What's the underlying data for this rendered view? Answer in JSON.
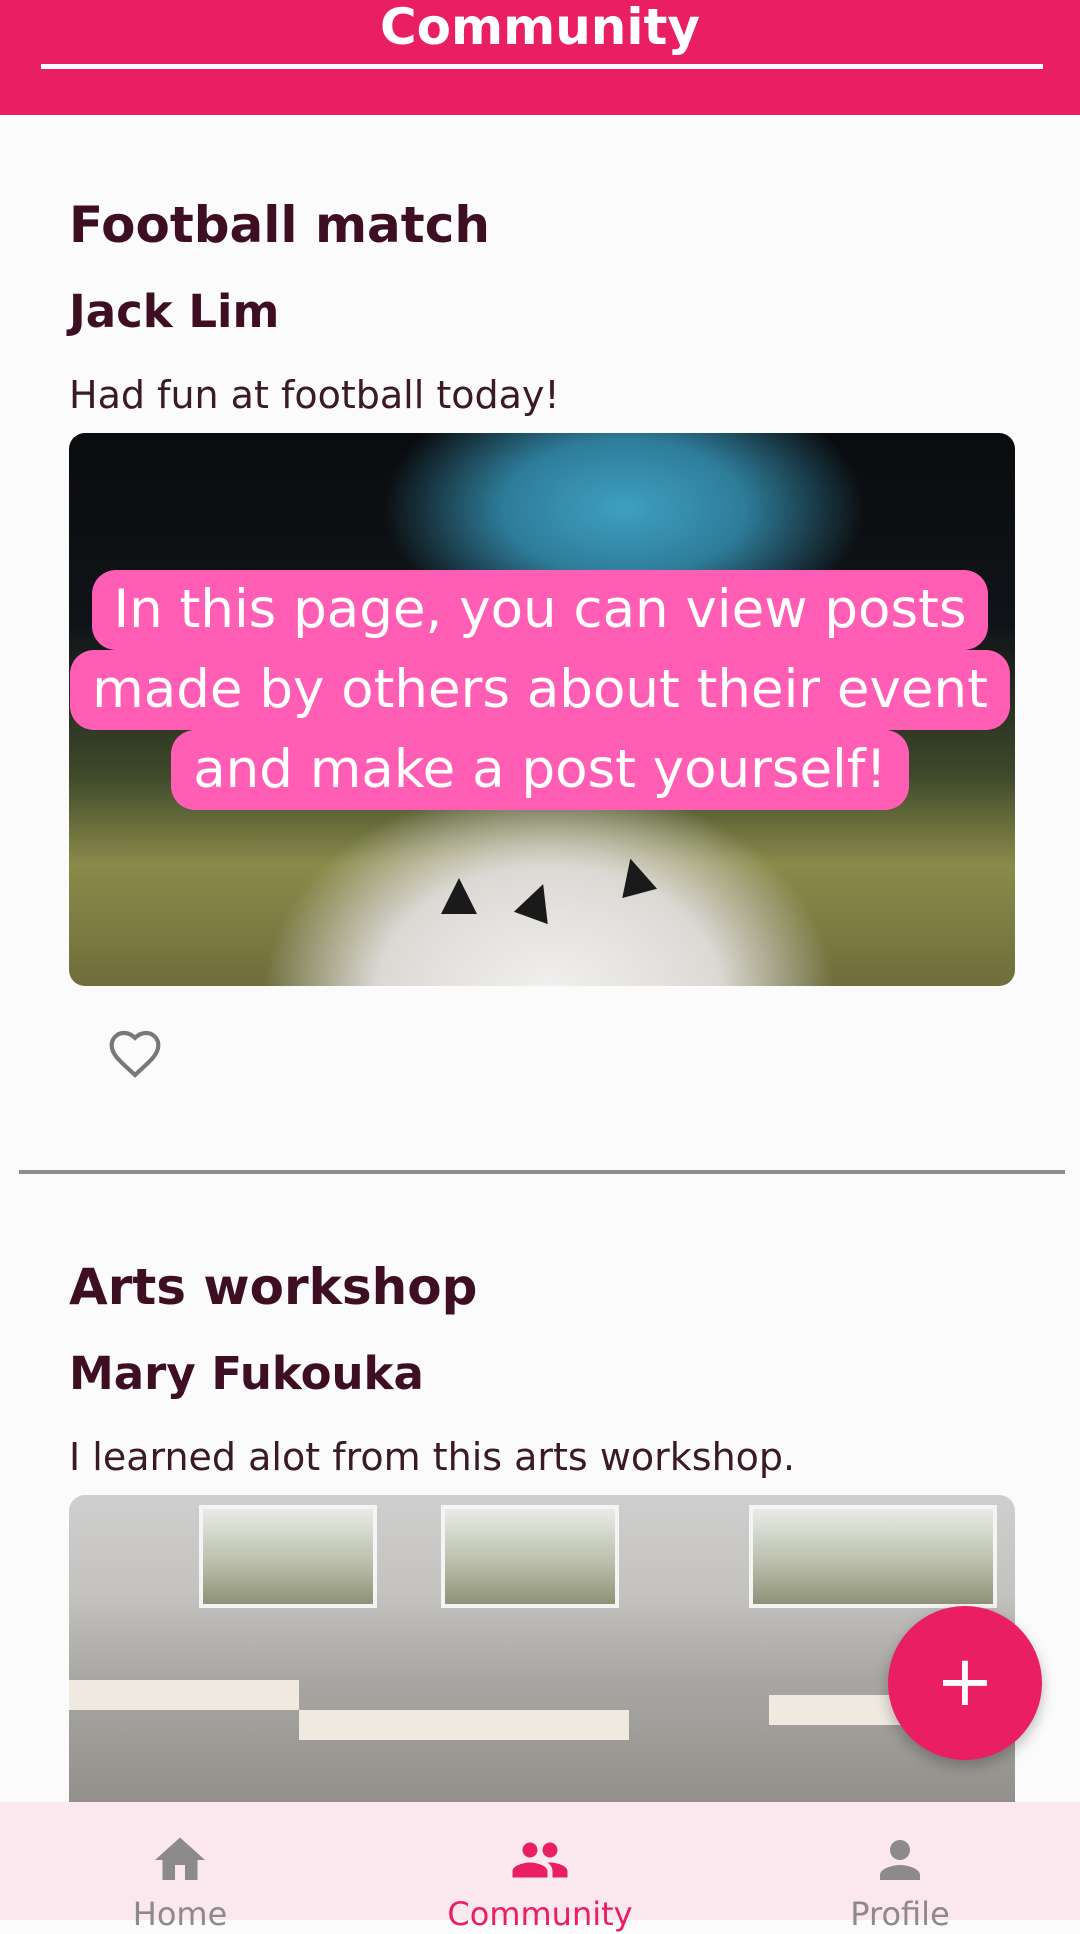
{
  "header": {
    "title": "Community"
  },
  "posts": [
    {
      "title": "Football match",
      "author": "Jack Lim",
      "text": "Had fun at football today!",
      "image": "football-photo"
    },
    {
      "title": "Arts workshop",
      "author": "Mary Fukouka",
      "text": "I learned alot from this arts workshop.",
      "image": "arts-workshop-photo"
    }
  ],
  "tooltip": {
    "line1": "In this page, you can view posts",
    "line2": "made by others about their event",
    "line3": "and make a post yourself!"
  },
  "fab": {
    "label": "+",
    "icon": "add-icon"
  },
  "bottom_nav": {
    "items": [
      {
        "label": "Home",
        "icon": "home-icon"
      },
      {
        "label": "Community",
        "icon": "people-icon",
        "active": true
      },
      {
        "label": "Profile",
        "icon": "person-icon"
      }
    ]
  },
  "colors": {
    "accent": "#e91e63",
    "tooltip_bg": "#ff5eb4",
    "nav_bg": "#fae8ee",
    "text_dark": "#3e0f22"
  }
}
